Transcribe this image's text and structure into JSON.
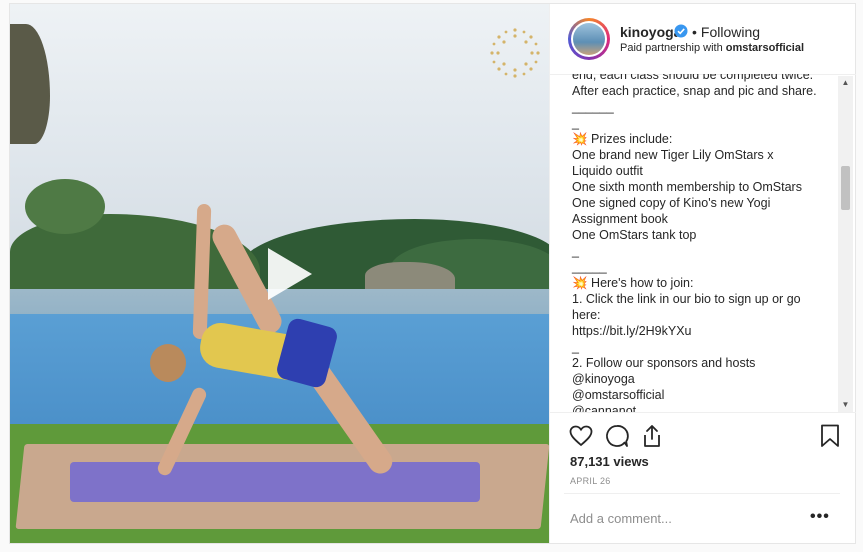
{
  "header": {
    "username": "kinoyoga",
    "following_label": "Following",
    "partnership_prefix": "Paid partnership with ",
    "partner": "omstarsofficial"
  },
  "caption": {
    "lines": [
      "end, each class should be completed twice.",
      "After each practice, snap and pic and share.",
      "______",
      "_",
      "💥 Prizes include:",
      "One brand new Tiger Lily OmStars x",
      "Liquido outfit",
      "One sixth month membership to OmStars",
      "One signed copy of Kino's new Yogi",
      "Assignment book",
      "One OmStars tank top",
      "_",
      "_____",
      "💥 Here's how to join:",
      "1. Click the link in our bio to sign up or go",
      "here:",
      "https://bit.ly/2H9kYXu",
      "_",
      "2. Follow our sponsors and hosts",
      "@kinoyoga",
      "@omstarsofficial",
      "@cannanot"
    ]
  },
  "stats": {
    "views": "87,131 views",
    "date": "APRIL 26"
  },
  "comment": {
    "placeholder": "Add a comment...",
    "more": "•••"
  },
  "colors": {
    "verified": "#3897f0",
    "text": "#262626",
    "muted": "#8e8e8e",
    "mat": "#7e72c9"
  }
}
